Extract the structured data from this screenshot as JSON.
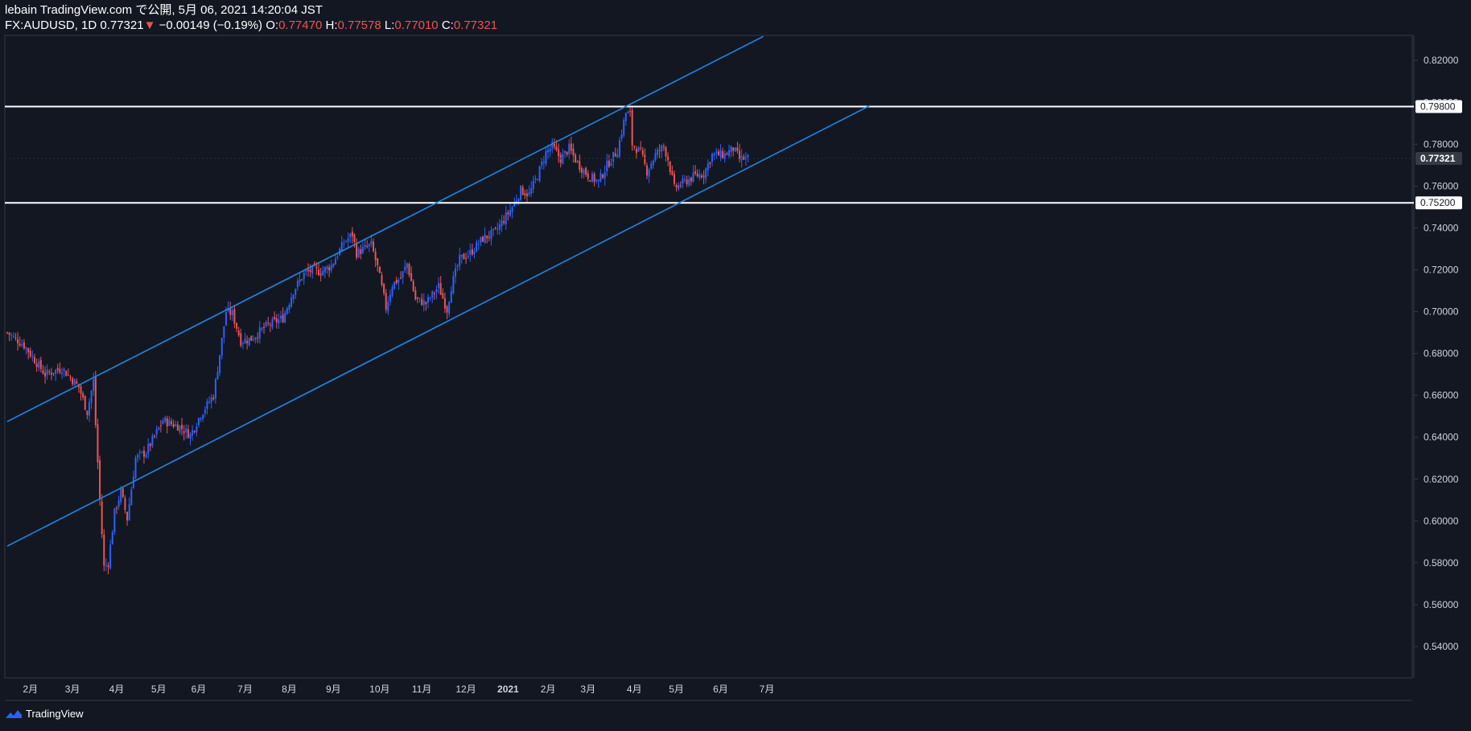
{
  "header": {
    "published": "lebain TradingView.com で公開, 5月 06, 2021 14:20:04 JST",
    "symbol": "FX:AUDUSD, 1D",
    "last": "0.77321",
    "arrow": "▼",
    "change": "−0.00149 (−0.19%)",
    "o_label": "O:",
    "o_value": "0.77470",
    "h_label": "H:",
    "h_value": "0.77578",
    "l_label": "L:",
    "l_value": "0.77010",
    "c_label": "C:",
    "c_value": "0.77321"
  },
  "footer": {
    "brand": "TradingView"
  },
  "colors": {
    "background": "#131722",
    "up": "#2962ff",
    "down": "#ef5350",
    "channel": "#1e88e5",
    "level": "#ffffff",
    "grid": "#1f2330",
    "axis_text": "#d1d4dc"
  },
  "chart_data": {
    "type": "candlestick",
    "symbol": "FX:AUDUSD",
    "timeframe": "1D",
    "yrange": [
      0.525,
      0.832
    ],
    "y_ticks": [
      "0.54000",
      "0.56000",
      "0.58000",
      "0.60000",
      "0.62000",
      "0.64000",
      "0.66000",
      "0.68000",
      "0.70000",
      "0.72000",
      "0.74000",
      "0.76000",
      "0.78000",
      "0.80000",
      "0.82000"
    ],
    "x_ticks": [
      "2月",
      "3月",
      "4月",
      "5月",
      "6月",
      "7月",
      "8月",
      "9月",
      "10月",
      "11月",
      "12月",
      "2021",
      "2月",
      "3月",
      "4月",
      "5月",
      "6月",
      "7月"
    ],
    "close_path": [
      [
        0,
        0.69
      ],
      [
        12,
        0.684
      ],
      [
        28,
        0.67
      ],
      [
        40,
        0.673
      ],
      [
        52,
        0.664
      ],
      [
        58,
        0.652
      ],
      [
        62,
        0.667
      ],
      [
        64,
        0.646
      ],
      [
        66,
        0.61
      ],
      [
        70,
        0.578
      ],
      [
        72,
        0.58
      ],
      [
        78,
        0.604
      ],
      [
        82,
        0.614
      ],
      [
        86,
        0.601
      ],
      [
        92,
        0.63
      ],
      [
        100,
        0.633
      ],
      [
        112,
        0.648
      ],
      [
        124,
        0.645
      ],
      [
        132,
        0.641
      ],
      [
        140,
        0.651
      ],
      [
        148,
        0.66
      ],
      [
        152,
        0.673
      ],
      [
        158,
        0.7
      ],
      [
        162,
        0.699
      ],
      [
        168,
        0.686
      ],
      [
        176,
        0.687
      ],
      [
        186,
        0.693
      ],
      [
        198,
        0.697
      ],
      [
        206,
        0.71
      ],
      [
        214,
        0.718
      ],
      [
        220,
        0.72
      ],
      [
        226,
        0.719
      ],
      [
        234,
        0.722
      ],
      [
        242,
        0.733
      ],
      [
        248,
        0.737
      ],
      [
        252,
        0.728
      ],
      [
        262,
        0.732
      ],
      [
        266,
        0.721
      ],
      [
        272,
        0.702
      ],
      [
        278,
        0.713
      ],
      [
        284,
        0.716
      ],
      [
        288,
        0.723
      ],
      [
        294,
        0.706
      ],
      [
        302,
        0.704
      ],
      [
        310,
        0.712
      ],
      [
        316,
        0.701
      ],
      [
        320,
        0.712
      ],
      [
        326,
        0.725
      ],
      [
        334,
        0.728
      ],
      [
        342,
        0.735
      ],
      [
        352,
        0.738
      ],
      [
        358,
        0.744
      ],
      [
        364,
        0.75
      ],
      [
        370,
        0.758
      ],
      [
        376,
        0.756
      ],
      [
        382,
        0.765
      ],
      [
        388,
        0.776
      ],
      [
        392,
        0.779
      ],
      [
        398,
        0.773
      ],
      [
        404,
        0.778
      ],
      [
        410,
        0.771
      ],
      [
        418,
        0.765
      ],
      [
        426,
        0.762
      ],
      [
        432,
        0.77
      ],
      [
        440,
        0.777
      ],
      [
        446,
        0.795
      ],
      [
        448,
        0.794
      ],
      [
        450,
        0.78
      ],
      [
        456,
        0.776
      ],
      [
        460,
        0.767
      ],
      [
        466,
        0.775
      ],
      [
        472,
        0.779
      ],
      [
        476,
        0.773
      ],
      [
        480,
        0.759
      ],
      [
        488,
        0.762
      ],
      [
        496,
        0.765
      ],
      [
        502,
        0.766
      ],
      [
        508,
        0.775
      ],
      [
        516,
        0.775
      ],
      [
        522,
        0.778
      ],
      [
        528,
        0.773
      ],
      [
        534,
        0.7732
      ]
    ],
    "horizontal_levels": [
      "0.79800",
      "0.75200"
    ],
    "current_price": "0.77321",
    "channel": {
      "upper": [
        [
          "2020-01-02",
          0.6475
        ],
        [
          "2021-05-19",
          0.8315
        ]
      ],
      "lower": [
        [
          "2020-01-02",
          0.588
        ],
        [
          "2021-07-29",
          0.7985
        ]
      ]
    }
  }
}
